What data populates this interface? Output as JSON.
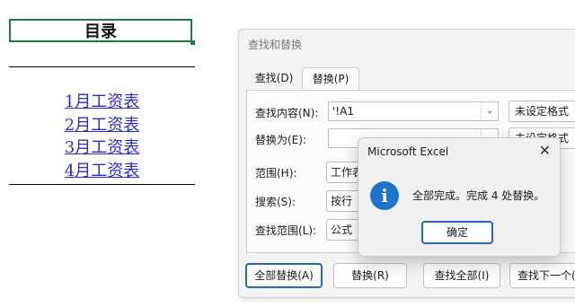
{
  "sheet": {
    "title": "目录",
    "links": [
      "1月工资表",
      "2月工资表",
      "3月工资表",
      "4月工资表"
    ]
  },
  "find_replace": {
    "title": "查找和替换",
    "tabs": [
      {
        "label": "查找(D)"
      },
      {
        "label": "替换(P)",
        "selected": true
      }
    ],
    "find_label": "查找内容(N):",
    "find_value": "'!A1",
    "replace_label": "替换为(E):",
    "replace_value": "",
    "format_button_1": "未设定格式",
    "format_button_2": "未设定格式",
    "scope_label": "范围(H):",
    "scope_value": "工作表",
    "search_label": "搜索(S):",
    "search_value": "按行",
    "lookin_label": "查找范围(L):",
    "lookin_value": "公式",
    "buttons": {
      "replace_all": "全部替换(A)",
      "replace": "替换(R)",
      "find_all": "查找全部(I)",
      "find_next": "查找下一个(F)"
    }
  },
  "message_box": {
    "title": "Microsoft Excel",
    "message": "全部完成。完成 4 处替换。",
    "ok_label": "确定",
    "icon": "info-icon"
  },
  "colors": {
    "link": "#2b2bd8",
    "selection": "#1f7a45",
    "accent": "#2c64b8",
    "info": "#1f72c9"
  }
}
